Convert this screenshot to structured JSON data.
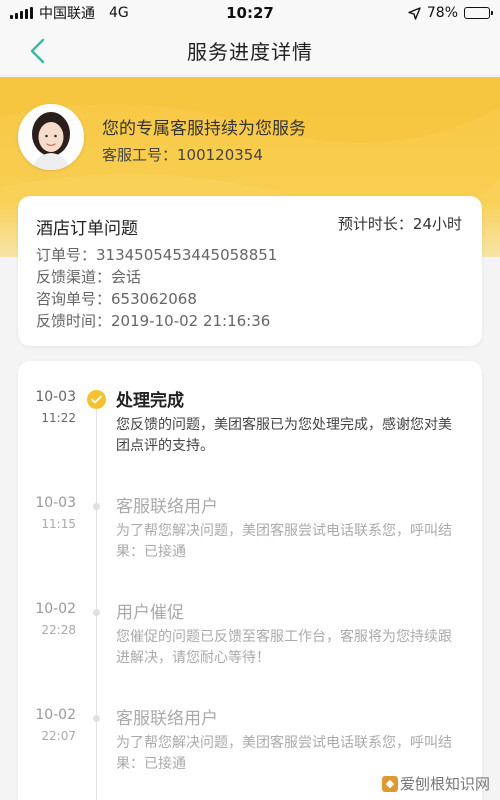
{
  "status_bar": {
    "carrier": "中国联通",
    "network": "4G",
    "time": "10:27",
    "battery": "78%",
    "battery_level": 0.78
  },
  "nav": {
    "title": "服务进度详情"
  },
  "agent": {
    "message": "您的专属客服持续为您服务",
    "id_label": "客服工号：100120354"
  },
  "order": {
    "title": "酒店订单问题",
    "eta": "预计时长：24小时",
    "rows": [
      "订单号：3134505453445058851",
      "反馈渠道：会话",
      "咨询单号：653062068",
      "反馈时间：2019-10-02 21:16:36"
    ]
  },
  "timeline": [
    {
      "date": "10-03",
      "time": "11:22",
      "title": "处理完成",
      "desc": "您反馈的问题，美团客服已为您处理完成，感谢您对美团点评的支持。",
      "active": true
    },
    {
      "date": "10-03",
      "time": "11:15",
      "title": "客服联络用户",
      "desc": "为了帮您解决问题，美团客服尝试电话联系您，呼叫结果：已接通",
      "active": false
    },
    {
      "date": "10-02",
      "time": "22:28",
      "title": "用户催促",
      "desc": "您催促的问题已反馈至客服工作台，客服将为您持续跟进解决，请您耐心等待！",
      "active": false
    },
    {
      "date": "10-02",
      "time": "22:07",
      "title": "客服联络用户",
      "desc": "为了帮您解决问题，美团客服尝试电话联系您，呼叫结果：已接通",
      "active": false
    }
  ],
  "watermark": "爱刨根知识网",
  "colors": {
    "accent": "#f5c132",
    "hero": "#f9cf52",
    "back_arrow": "#3cb8a0"
  },
  "icons": {
    "back": "chevron-left-icon",
    "check": "check-icon",
    "location": "location-arrow-icon"
  }
}
